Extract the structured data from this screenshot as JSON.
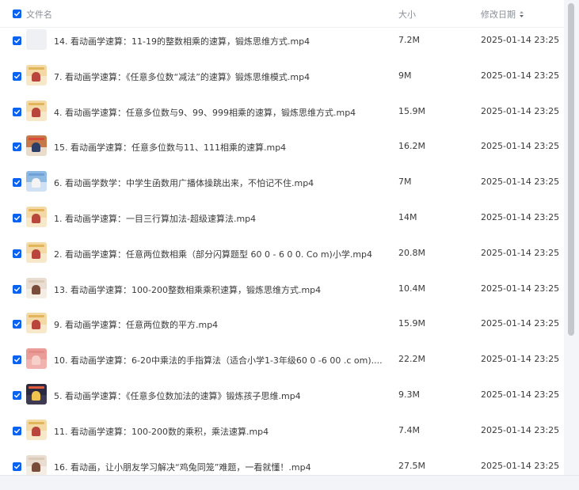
{
  "header": {
    "name_label": "文件名",
    "size_label": "大小",
    "date_label": "修改日期"
  },
  "files": [
    {
      "name": "14. 看动画学速算：11-19的整数相乘的速算，锻炼思维方式.mp4",
      "size": "7.2M",
      "date": "2025-01-14 23:25",
      "thumb": "blank"
    },
    {
      "name": "7. 看动画学速算：《任意多位数“减法”的速算》锻炼思维模式.mp4",
      "size": "9M",
      "date": "2025-01-14 23:25",
      "thumb": "cartoon"
    },
    {
      "name": "4. 看动画学速算：任意多位数与9、99、999相乘的速算，锻炼思维方式.mp4",
      "size": "15.9M",
      "date": "2025-01-14 23:25",
      "thumb": "cartoon"
    },
    {
      "name": "15. 看动画学速算：任意多位数与11、111相乘的速算.mp4",
      "size": "16.2M",
      "date": "2025-01-14 23:25",
      "thumb": "classroom"
    },
    {
      "name": "6. 看动画学数学：中学生函数用广播体操跳出来，不怕记不住.mp4",
      "size": "7M",
      "date": "2025-01-14 23:25",
      "thumb": "blue"
    },
    {
      "name": "1. 看动画学速算：一目三行算加法-超级速算法.mp4",
      "size": "14M",
      "date": "2025-01-14 23:25",
      "thumb": "cartoon"
    },
    {
      "name": "2. 看动画学速算：任意两位数相乘（部分闪算题型 60 0 - 6 0 0. Co m)小学.mp4",
      "size": "20.8M",
      "date": "2025-01-14 23:25",
      "thumb": "cartoon"
    },
    {
      "name": "13. 看动画学速算：100-200整数相乘乘积速算，锻炼思维方式.mp4",
      "size": "10.4M",
      "date": "2025-01-14 23:25",
      "thumb": "desk"
    },
    {
      "name": "9. 看动画学速算：任意两位数的平方.mp4",
      "size": "15.9M",
      "date": "2025-01-14 23:25",
      "thumb": "cartoon"
    },
    {
      "name": "10. 看动画学速算：6-20中乘法的手指算法（适合小学1-3年级60 0 -6 00 .c om)....",
      "size": "22.2M",
      "date": "2025-01-14 23:25",
      "thumb": "pink"
    },
    {
      "name": "5. 看动画学速算：《任意多位数加法的速算》锻炼孩子思维.mp4",
      "size": "9.3M",
      "date": "2025-01-14 23:25",
      "thumb": "dark"
    },
    {
      "name": "11. 看动画学速算：100-200数的乘积，乘法速算.mp4",
      "size": "7.4M",
      "date": "2025-01-14 23:25",
      "thumb": "cartoon"
    },
    {
      "name": "16. 看动画，让小朋友学习解决“鸡兔同笼”难题，一看就懂！.mp4",
      "size": "27.5M",
      "date": "2025-01-14 23:25",
      "thumb": "desk"
    }
  ],
  "colors": {
    "checkbox": "#0a63f0",
    "scroll_thumb": "#c4c7cd"
  }
}
